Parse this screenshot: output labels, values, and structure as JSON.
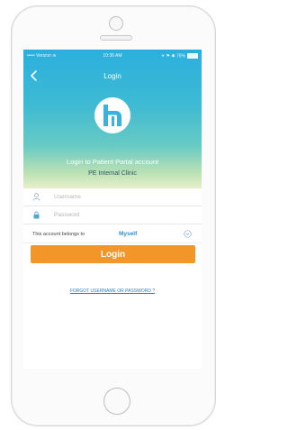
{
  "status_bar": {
    "carrier": "•••••  Verizon  ≋",
    "time": "10:36 AM",
    "battery": "✈ ⚑ ✱ 76%"
  },
  "nav": {
    "title": "Login",
    "back_icon": "chevron-left-icon"
  },
  "hero": {
    "logo_icon": "portal-logo-icon",
    "line1": "Login to Patient Portal account",
    "line2": "PE Internal Clinic"
  },
  "form": {
    "username_placeholder": "Username",
    "password_placeholder": "Password",
    "username_icon": "user-icon",
    "password_icon": "lock-icon",
    "belongs_label": "This account belongs to",
    "belongs_value": "Myself",
    "belongs_chevron_icon": "chevron-down-icon",
    "login_label": "Login",
    "forgot_label": "FORGOT USERNAME OR PASSWORD ?"
  },
  "colors": {
    "accent_blue": "#2ab0de",
    "login_orange": "#f3962a",
    "link_blue": "#2d8fd5"
  }
}
